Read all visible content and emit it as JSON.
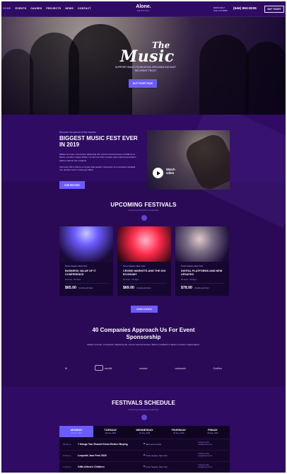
{
  "header": {
    "nav": [
      "HOME",
      "EVENTS",
      "CAUSES",
      "PROJECTS",
      "NEWS",
      "CONTACT"
    ],
    "brand": {
      "name": "Alone.",
      "tagline": "FESTIVAL"
    },
    "help": {
      "line1": "NEED HELP",
      "line2": "CALL US NOW"
    },
    "phone": "(646) 863-8226",
    "buy_ticket": "BUY TICKET"
  },
  "hero": {
    "script_top": "The",
    "script_main": "Music",
    "subtitle": "SUPPORT BUILD FOUNDATION GROUNDS\nDUI EAST RECIPIENT TROUT",
    "button": "BUY TICKET NOW"
  },
  "feature": {
    "kicker": "Discover fun pieces of the months",
    "title": "BIGGEST MUSIC FEST EVER IN 2019",
    "para1": "Master an amet, consectetur adipiscing elit, sed do eiusmod tempor incididunt ut labore et dolore magna aliqua. Ut enim ad minim veniam quis nostrud exercitation ullamco laboris nisi ut aliquip.",
    "para2": "Velit esse cillum dolore eu fugiat nulla pariatur. Excepteur sint occaecat cupidatat non proident sunt in culpa qui officia.",
    "button": "OUR HISTORY",
    "video_label_1": "Watch",
    "video_label_2": "video"
  },
  "upcoming": {
    "title": "UPCOMING FESTIVALS",
    "subtitle": "Improving workplace productivity",
    "cards": [
      {
        "kicker": "Times Square, New York",
        "title": "BUSINESS VALUE OF IT CONFERENCE",
        "date": "22 June - 25 days",
        "price": "$65.00",
        "note": "Including all ticket"
      },
      {
        "kicker": "Times Square, New York",
        "title": "CROWD MARKETS AND THE GIG ECONOMY",
        "date": "22 June - 25 days",
        "price": "$69.00",
        "note": "Including all ticket"
      },
      {
        "kicker": "Times Square, New York",
        "title": "DIGITAL PLATFORMS AND NEW UPDATES",
        "date": "22 June - 25 days",
        "price": "$78.00",
        "note": "Including all ticket"
      }
    ],
    "more_button": "MORE EVENTS"
  },
  "sponsorship": {
    "title": "40 Companies Approach Us For Event Sponsorship",
    "text": "Master sit amet, consectetur adipiscing elit, sed do eiusmod tempor ullamco incididunt ut labore et dolore magna aliqua.",
    "logos": [
      "N",
      "mollit",
      "music",
      "network",
      "Coffee"
    ]
  },
  "schedule": {
    "title": "FESTIVALS SCHEDULE",
    "subtitle": "Improving workplace productivity",
    "days": [
      {
        "name": "MONDAY",
        "date": "22 June, 2019",
        "active": true
      },
      {
        "name": "TUESDAY",
        "date": "23 June, 2019",
        "active": false
      },
      {
        "name": "WEDNESDAY",
        "date": "24 June, 2019",
        "active": false
      },
      {
        "name": "THURSDAY",
        "date": "25 June, 2019",
        "active": false
      },
      {
        "name": "FRIDAY",
        "date": "26 June, 2019",
        "active": false
      }
    ],
    "rows": [
      {
        "time": "09:00 am",
        "title": "7 things You Should Know Before Buying",
        "location": "SEO Venue Hotel",
        "right1": "Conference By",
        "right2": "sean@roberts.com"
      },
      {
        "time": "10:00 am",
        "title": "Leopolis Jazz Fest 2020",
        "location": "Times Square, New York",
        "right1": "Conference By",
        "right2": "sean@roberts.com"
      },
      {
        "time": "11:00 am",
        "title": "Gifts Africa's Children",
        "location": "Times Square, New York",
        "right1": "Conference By",
        "right2": "sean@roberts.com"
      }
    ]
  },
  "colors": {
    "page_bg": "#2a0a57",
    "header_bg": "#2f0b63",
    "accent": "#6b5cff",
    "muted": "#8f80e8"
  }
}
